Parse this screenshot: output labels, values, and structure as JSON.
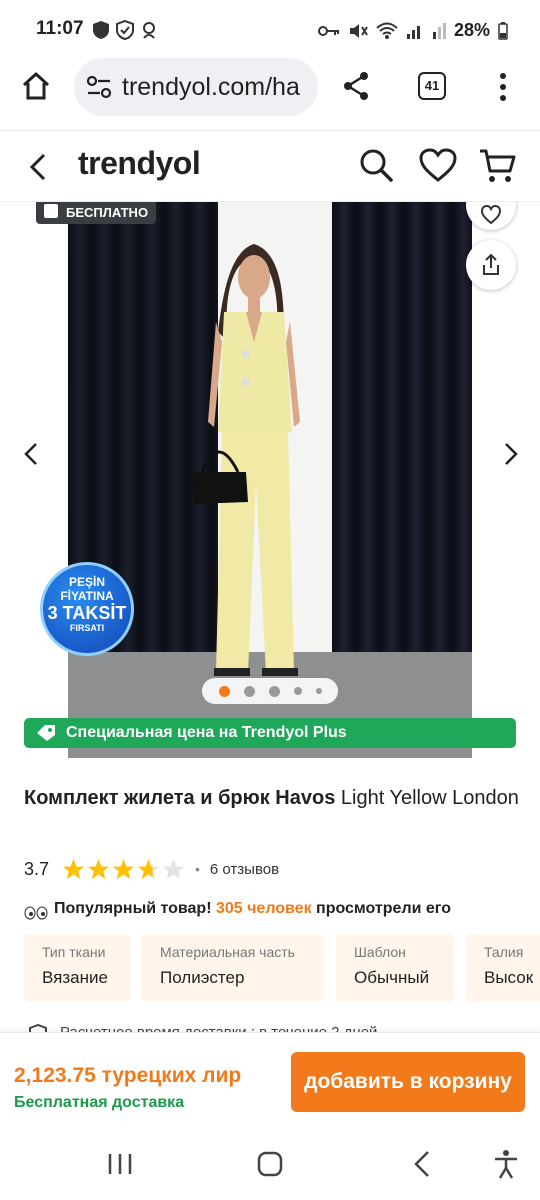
{
  "status_bar": {
    "time": "11:07",
    "battery": "28%"
  },
  "browser": {
    "url": "trendyol.com/ha",
    "tab_count": "41"
  },
  "site": {
    "logo": "trendyol"
  },
  "gallery": {
    "free_badge": "БЕСПЛАТНО",
    "taksit_badge": {
      "line1": "PEŞİN",
      "line2": "FİYATINA",
      "line3": "3 TAKSİT",
      "line4": "FIRSATI"
    },
    "pagination": {
      "total": 5,
      "active": 1
    },
    "plus_banner": "Специальная цена на Trendyol Plus"
  },
  "product": {
    "title_main": "Комплект жилета и брюк",
    "brand": "Havos",
    "title_rest": "Light Yellow London",
    "rating": "3.7",
    "rating_value": 3.7,
    "reviews": "6 отзывов",
    "popular": {
      "prefix": "Популярный товар!",
      "count": "305 человек",
      "suffix": "просмотрели его"
    },
    "attributes": [
      {
        "key": "Тип ткани",
        "value": "Вязание"
      },
      {
        "key": "Материальная часть",
        "value": "Полиэстер"
      },
      {
        "key": "Шаблон",
        "value": "Обычный"
      },
      {
        "key": "Талия",
        "value": "Высок"
      }
    ],
    "delivery": "Расчетное время доставки : в течение 2 дней"
  },
  "buy_bar": {
    "price": "2,123.75 турецких лир",
    "shipping": "Бесплатная доставка",
    "add_to_cart": "добавить в корзину"
  },
  "colors": {
    "accent": "#f27a1a",
    "green": "#1fa85a",
    "attr_bg": "#fff5ea"
  }
}
